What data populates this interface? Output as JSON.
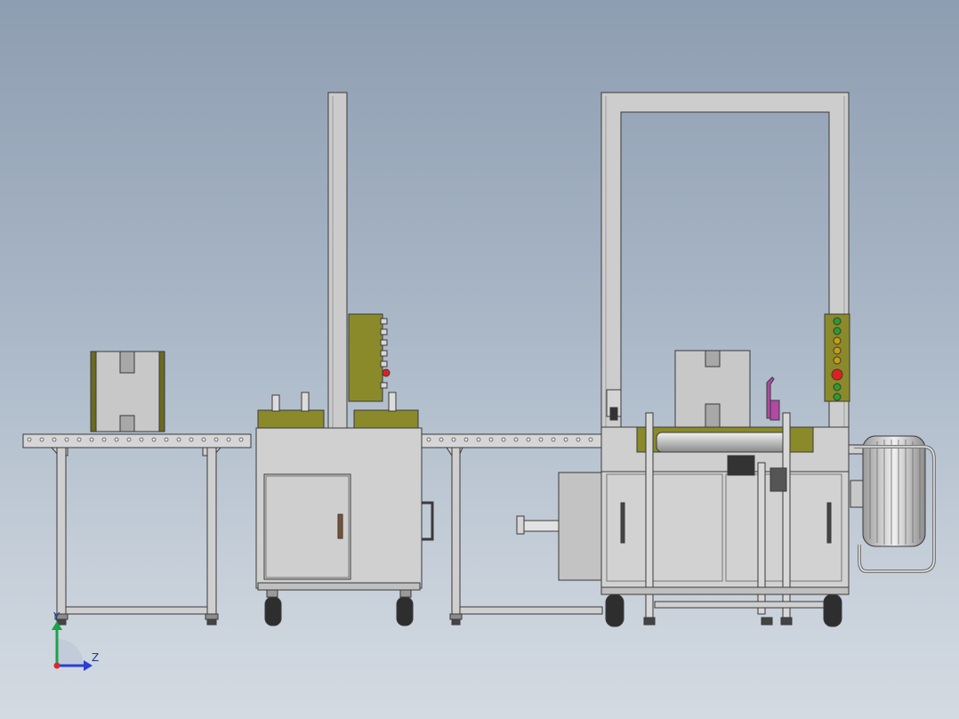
{
  "triad": {
    "y_label": "Y",
    "z_label": "Z"
  },
  "colors": {
    "frame": "#c9c9c9",
    "panel": "#d0d0d0",
    "outline": "#3a3a3a",
    "olive": "#8a8a2a",
    "box": "#c6c6c6",
    "box_edge": "#6b6b20",
    "roller": "#dcdcdc",
    "wheel": "#2e2e2e",
    "light_green": "#2a9d2a",
    "light_red": "#e02020",
    "light_amber": "#c99a12",
    "magenta": "#b04aa3",
    "y_axis": "#1aa34a",
    "z_axis": "#2a3fd6",
    "origin": "#d62a2a"
  },
  "components": [
    "infeed-conveyor",
    "carton",
    "top-sealer",
    "sealer-control-panel",
    "transfer-conveyor",
    "strapping-arch",
    "arch-control-panel",
    "strapping-unit",
    "strap-coil-reel",
    "pneumatic-cylinder"
  ]
}
